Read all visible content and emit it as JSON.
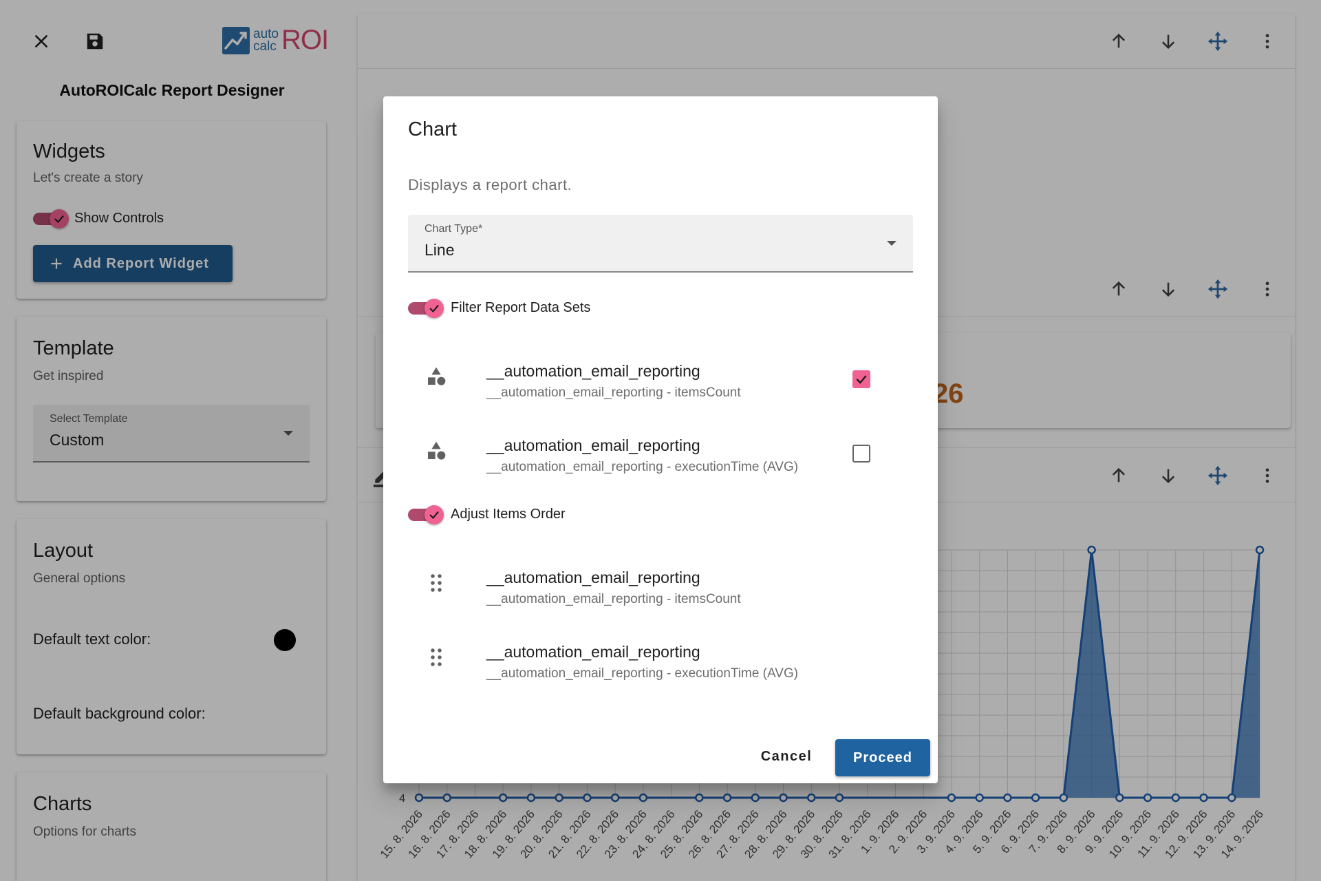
{
  "app": {
    "title": "AutoROICalc Report Designer",
    "logo": {
      "small_top": "auto",
      "small_bottom": "calc",
      "big": "ROI",
      "colors": {
        "blue": "#2f6fa8",
        "pink": "#d1486b"
      }
    }
  },
  "sidebar": {
    "widgets": {
      "title": "Widgets",
      "subtitle": "Let's create a story",
      "show_controls_label": "Show Controls",
      "show_controls_on": true,
      "add_button_label": "Add Report Widget"
    },
    "template": {
      "title": "Template",
      "subtitle": "Get inspired",
      "select_label": "Select Template",
      "select_value": "Custom"
    },
    "layout": {
      "title": "Layout",
      "subtitle": "General options",
      "text_color_label": "Default text color:",
      "text_color_value": "#000000",
      "bg_color_label": "Default background color:"
    },
    "charts": {
      "title": "Charts",
      "subtitle": "Options for charts"
    }
  },
  "main": {
    "kpi_partial": "26"
  },
  "dialog": {
    "title": "Chart",
    "description": "Displays a report chart.",
    "chart_type_label": "Chart Type*",
    "chart_type_value": "Line",
    "filter_toggle_label": "Filter Report Data Sets",
    "filter_toggle_on": true,
    "datasets": [
      {
        "title": "__automation_email_reporting",
        "subtitle": "__automation_email_reporting - itemsCount",
        "checked": true,
        "icon": "category-shapes-icon"
      },
      {
        "title": "__automation_email_reporting",
        "subtitle": "__automation_email_reporting - executionTime (AVG)",
        "checked": false,
        "icon": "category-shapes-icon"
      }
    ],
    "order_toggle_label": "Adjust Items Order",
    "order_toggle_on": true,
    "order_items": [
      {
        "title": "__automation_email_reporting",
        "subtitle": "__automation_email_reporting - itemsCount",
        "icon": "drag-handle-icon"
      },
      {
        "title": "__automation_email_reporting",
        "subtitle": "__automation_email_reporting - executionTime (AVG)",
        "icon": "drag-handle-icon"
      }
    ],
    "cancel_label": "Cancel",
    "proceed_label": "Proceed"
  },
  "colors": {
    "accent_pink": "#f06292",
    "primary_blue": "#1f5c8f",
    "chart_fill": "#2f6fb5"
  },
  "chart_data": {
    "type": "area",
    "x": [
      "15. 8. 2026",
      "16. 8. 2026",
      "17. 8. 2026",
      "18. 8. 2026",
      "19. 8. 2026",
      "20. 8. 2026",
      "21. 8. 2026",
      "22. 8. 2026",
      "23. 8. 2026",
      "24. 8. 2026",
      "25. 8. 2026",
      "26. 8. 2026",
      "27. 8. 2026",
      "28. 8. 2026",
      "29. 8. 2026",
      "30. 8. 2026",
      "31. 8. 2026",
      "1. 9. 2026",
      "2. 9. 2026",
      "3. 9. 2026",
      "4. 9. 2026",
      "5. 9. 2026",
      "6. 9. 2026",
      "7. 9. 2026",
      "8. 9. 2026",
      "9. 9. 2026",
      "10. 9. 2026",
      "11. 9. 2026",
      "12. 9. 2026",
      "13. 9. 2026",
      "14. 9. 2026"
    ],
    "values": [
      4,
      4,
      null,
      4,
      4,
      4,
      4,
      4,
      4,
      null,
      4,
      4,
      4,
      4,
      4,
      4,
      null,
      null,
      null,
      4,
      4,
      4,
      4,
      4,
      5,
      4,
      4,
      4,
      4,
      4,
      5
    ],
    "y_tick_labels": [
      "4"
    ],
    "grid": true,
    "title": "",
    "xlabel": "",
    "ylabel": ""
  }
}
